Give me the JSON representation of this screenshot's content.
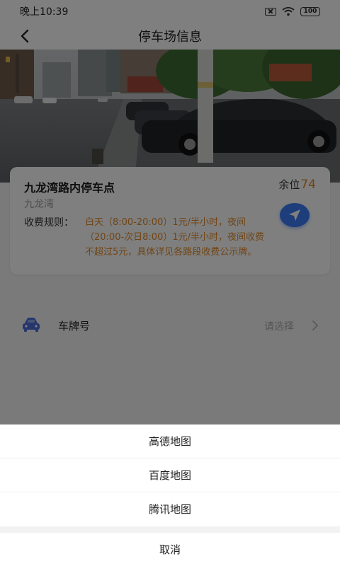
{
  "status_bar": {
    "time": "晚上10:39",
    "battery": "100",
    "icons": [
      "sim-off-icon",
      "wifi-icon",
      "battery-icon"
    ]
  },
  "header": {
    "title": "停车场信息",
    "back_icon": "chevron-left-icon"
  },
  "lot": {
    "name": "九龙湾路内停车点",
    "area": "九龙湾",
    "spaces_label": "余位",
    "spaces_count": "74",
    "rules_label": "收费规则：",
    "rules_text": "白天（8:00-20:00）1元/半小时，夜间（20:00-次日8:00）1元/半小时，夜间收费不超过5元，具体详见各路段收费公示牌。",
    "navigate_icon": "navigation-arrow-icon"
  },
  "plate": {
    "label": "车牌号",
    "placeholder": "请选择",
    "icon": "car-icon"
  },
  "sheet": {
    "options": [
      "高德地图",
      "百度地图",
      "腾讯地图"
    ],
    "cancel": "取消"
  },
  "colors": {
    "accent_orange": "#e08a2a",
    "nav_blue": "#3b7bf6",
    "car_icon_blue": "#4a6fd8"
  }
}
